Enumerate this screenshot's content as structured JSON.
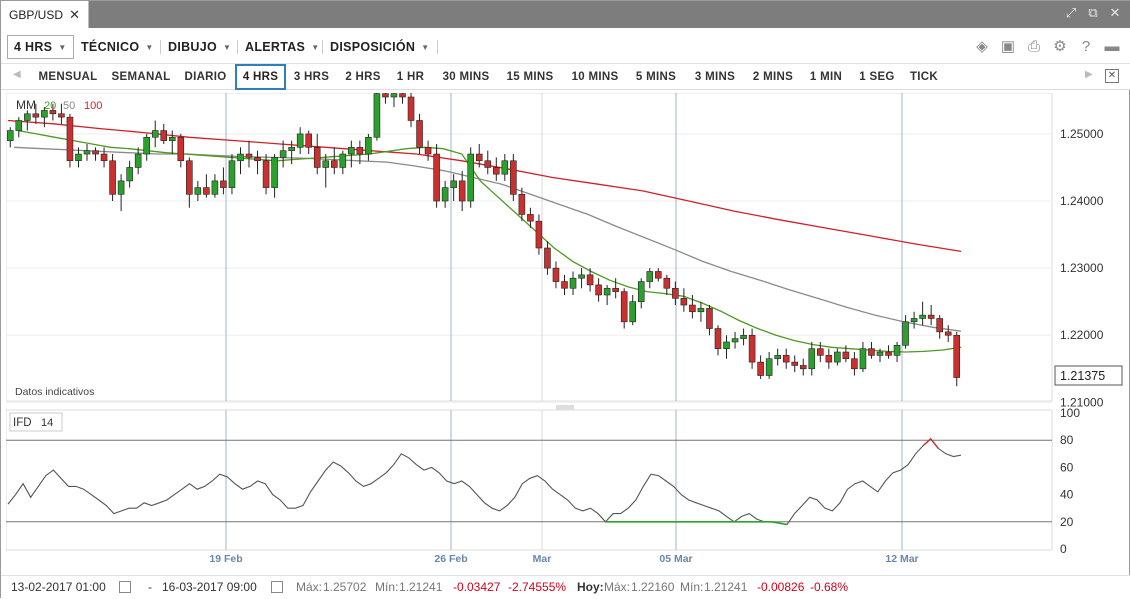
{
  "window": {
    "tab_label": "GBP/USD",
    "close_glyph": "✕"
  },
  "toolbar": {
    "timeframe_label": "4 HRS",
    "menus": [
      "TÉCNICO",
      "DIBUJO",
      "ALERTAS",
      "DISPOSICIÓN"
    ]
  },
  "timeframes": [
    "MENSUAL",
    "SEMANAL",
    "DIARIO",
    "4 HRS",
    "3 HRS",
    "2 HRS",
    "1 HR",
    "30 MINS",
    "15 MINS",
    "10 MINS",
    "5 MINS",
    "3 MINS",
    "2 MINS",
    "1 MIN",
    "1 SEG",
    "TICK"
  ],
  "active_timeframe": "4 HRS",
  "indicator_legend": {
    "name": "MM",
    "p20": "20",
    "p50": "50",
    "p100": "100"
  },
  "indicative_note": "Datos indicativos",
  "current_price": "1.21375",
  "ifd_legend": {
    "name": "IFD",
    "period": "14"
  },
  "footer": {
    "from": "13-02-2017 01:00",
    "dash": "-",
    "to": "16-03-2017 09:00",
    "max_label": "Máx:",
    "max_value": "1.25702",
    "min_label": "Mín:",
    "min_value": "1.21241",
    "change": "-0.03427",
    "change_pct": "-2.74555%",
    "today_label": "Hoy:",
    "today_max_label": "Máx:",
    "today_max_value": "1.22160",
    "today_min_label": "Mín:",
    "today_min_value": "1.21241",
    "today_change": "-0.00826",
    "today_change_pct": "-0.68%"
  },
  "colors": {
    "up": "#2ca02c",
    "down": "#c8312f",
    "ma20": "#4e9a1f",
    "ma50": "#8a8a8a",
    "ma100": "#d0202a"
  },
  "chart_data": [
    {
      "type": "candlestick",
      "title": "GBP/USD",
      "x_ticks": [
        "19 Feb",
        "26 Feb",
        "Mar",
        "05 Mar",
        "12 Mar"
      ],
      "y_ticks": [
        "1.25000",
        "1.24000",
        "1.23000",
        "1.22000",
        "1.21000"
      ],
      "ylim": [
        1.21,
        1.255
      ],
      "ohlc": [
        [
          1.249,
          1.251,
          1.248,
          1.2505
        ],
        [
          1.2505,
          1.2525,
          1.2495,
          1.252
        ],
        [
          1.252,
          1.2535,
          1.2505,
          1.253
        ],
        [
          1.253,
          1.2545,
          1.2515,
          1.2525
        ],
        [
          1.2525,
          1.254,
          1.251,
          1.2535
        ],
        [
          1.2535,
          1.2545,
          1.252,
          1.253
        ],
        [
          1.253,
          1.2545,
          1.2515,
          1.2525
        ],
        [
          1.2525,
          1.253,
          1.245,
          1.246
        ],
        [
          1.246,
          1.248,
          1.245,
          1.247
        ],
        [
          1.247,
          1.2485,
          1.246,
          1.2475
        ],
        [
          1.2475,
          1.248,
          1.246,
          1.247
        ],
        [
          1.247,
          1.248,
          1.245,
          1.246
        ],
        [
          1.246,
          1.247,
          1.24,
          1.241
        ],
        [
          1.241,
          1.244,
          1.2385,
          1.243
        ],
        [
          1.243,
          1.246,
          1.242,
          1.245
        ],
        [
          1.245,
          1.248,
          1.244,
          1.247
        ],
        [
          1.247,
          1.25,
          1.246,
          1.2495
        ],
        [
          1.2495,
          1.252,
          1.248,
          1.2505
        ],
        [
          1.2505,
          1.2515,
          1.2485,
          1.249
        ],
        [
          1.249,
          1.2505,
          1.247,
          1.2495
        ],
        [
          1.2495,
          1.25,
          1.245,
          1.246
        ],
        [
          1.246,
          1.2465,
          1.239,
          1.241
        ],
        [
          1.241,
          1.243,
          1.24,
          1.242
        ],
        [
          1.242,
          1.244,
          1.2405,
          1.241
        ],
        [
          1.241,
          1.244,
          1.2405,
          1.243
        ],
        [
          1.243,
          1.245,
          1.241,
          1.242
        ],
        [
          1.242,
          1.247,
          1.241,
          1.246
        ],
        [
          1.246,
          1.248,
          1.244,
          1.247
        ],
        [
          1.247,
          1.249,
          1.245,
          1.2465
        ],
        [
          1.2465,
          1.2475,
          1.244,
          1.246
        ],
        [
          1.246,
          1.247,
          1.241,
          1.242
        ],
        [
          1.242,
          1.247,
          1.2405,
          1.2465
        ],
        [
          1.2465,
          1.249,
          1.245,
          1.2475
        ],
        [
          1.2475,
          1.249,
          1.2455,
          1.248
        ],
        [
          1.248,
          1.251,
          1.247,
          1.25
        ],
        [
          1.25,
          1.2505,
          1.247,
          1.248
        ],
        [
          1.248,
          1.25,
          1.244,
          1.245
        ],
        [
          1.245,
          1.247,
          1.242,
          1.246
        ],
        [
          1.246,
          1.248,
          1.244,
          1.245
        ],
        [
          1.245,
          1.2475,
          1.244,
          1.247
        ],
        [
          1.247,
          1.249,
          1.245,
          1.248
        ],
        [
          1.248,
          1.249,
          1.2455,
          1.247
        ],
        [
          1.247,
          1.25,
          1.246,
          1.2495
        ],
        [
          1.2495,
          1.257,
          1.249,
          1.256
        ],
        [
          1.256,
          1.2575,
          1.2545,
          1.2555
        ],
        [
          1.2555,
          1.257,
          1.254,
          1.256
        ],
        [
          1.256,
          1.2572,
          1.2545,
          1.2555
        ],
        [
          1.2555,
          1.257,
          1.251,
          1.252
        ],
        [
          1.252,
          1.253,
          1.247,
          1.248
        ],
        [
          1.248,
          1.249,
          1.246,
          1.247
        ],
        [
          1.247,
          1.2485,
          1.239,
          1.24
        ],
        [
          1.24,
          1.243,
          1.239,
          1.242
        ],
        [
          1.242,
          1.244,
          1.24,
          1.243
        ],
        [
          1.243,
          1.2445,
          1.2385,
          1.24
        ],
        [
          1.24,
          1.248,
          1.239,
          1.247
        ],
        [
          1.247,
          1.2485,
          1.245,
          1.246
        ],
        [
          1.246,
          1.2475,
          1.244,
          1.245
        ],
        [
          1.245,
          1.2465,
          1.243,
          1.244
        ],
        [
          1.244,
          1.247,
          1.243,
          1.246
        ],
        [
          1.246,
          1.247,
          1.24,
          1.241
        ],
        [
          1.241,
          1.242,
          1.237,
          1.238
        ],
        [
          1.238,
          1.239,
          1.236,
          1.237
        ],
        [
          1.237,
          1.238,
          1.232,
          1.233
        ],
        [
          1.233,
          1.234,
          1.229,
          1.23
        ],
        [
          1.23,
          1.231,
          1.227,
          1.228
        ],
        [
          1.228,
          1.229,
          1.226,
          1.227
        ],
        [
          1.227,
          1.2295,
          1.226,
          1.2285
        ],
        [
          1.2285,
          1.23,
          1.227,
          1.229
        ],
        [
          1.229,
          1.23,
          1.2265,
          1.2275
        ],
        [
          1.2275,
          1.2285,
          1.225,
          1.226
        ],
        [
          1.226,
          1.2275,
          1.2245,
          1.227
        ],
        [
          1.227,
          1.2285,
          1.2255,
          1.2265
        ],
        [
          1.2265,
          1.227,
          1.221,
          1.222
        ],
        [
          1.222,
          1.226,
          1.2215,
          1.225
        ],
        [
          1.225,
          1.2285,
          1.224,
          1.228
        ],
        [
          1.228,
          1.23,
          1.227,
          1.2295
        ],
        [
          1.2295,
          1.23,
          1.228,
          1.2285
        ],
        [
          1.2285,
          1.229,
          1.226,
          1.227
        ],
        [
          1.227,
          1.228,
          1.2245,
          1.2255
        ],
        [
          1.2255,
          1.227,
          1.2235,
          1.2245
        ],
        [
          1.2245,
          1.226,
          1.2225,
          1.2235
        ],
        [
          1.2235,
          1.225,
          1.222,
          1.224
        ],
        [
          1.224,
          1.2245,
          1.22,
          1.221
        ],
        [
          1.221,
          1.2215,
          1.217,
          1.218
        ],
        [
          1.218,
          1.22,
          1.2165,
          1.219
        ],
        [
          1.219,
          1.2205,
          1.218,
          1.2195
        ],
        [
          1.2195,
          1.221,
          1.2185,
          1.22
        ],
        [
          1.22,
          1.221,
          1.215,
          1.216
        ],
        [
          1.216,
          1.217,
          1.2135,
          1.214
        ],
        [
          1.214,
          1.2175,
          1.2135,
          1.2165
        ],
        [
          1.2165,
          1.218,
          1.2155,
          1.217
        ],
        [
          1.217,
          1.218,
          1.215,
          1.216
        ],
        [
          1.216,
          1.217,
          1.2145,
          1.2155
        ],
        [
          1.2155,
          1.2165,
          1.214,
          1.215
        ],
        [
          1.215,
          1.219,
          1.214,
          1.218
        ],
        [
          1.218,
          1.219,
          1.216,
          1.217
        ],
        [
          1.217,
          1.218,
          1.215,
          1.216
        ],
        [
          1.216,
          1.218,
          1.2155,
          1.2175
        ],
        [
          1.2175,
          1.2185,
          1.216,
          1.2165
        ],
        [
          1.2165,
          1.2175,
          1.214,
          1.215
        ],
        [
          1.215,
          1.219,
          1.2145,
          1.218
        ],
        [
          1.218,
          1.219,
          1.2165,
          1.217
        ],
        [
          1.217,
          1.218,
          1.216,
          1.2175
        ],
        [
          1.2175,
          1.2185,
          1.2165,
          1.217
        ],
        [
          1.217,
          1.219,
          1.216,
          1.2185
        ],
        [
          1.2185,
          1.223,
          1.218,
          1.222
        ],
        [
          1.222,
          1.2235,
          1.221,
          1.2225
        ],
        [
          1.2225,
          1.225,
          1.2215,
          1.223
        ],
        [
          1.223,
          1.2245,
          1.2215,
          1.2225
        ],
        [
          1.2225,
          1.223,
          1.2195,
          1.2205
        ],
        [
          1.2205,
          1.2215,
          1.219,
          1.22
        ],
        [
          1.22,
          1.2205,
          1.2124,
          1.2137
        ]
      ],
      "ma20": [
        1.2505,
        1.25,
        1.2495,
        1.249,
        1.2485,
        1.248,
        1.2478,
        1.2475,
        1.2472,
        1.247,
        1.2468,
        1.2466,
        1.2464,
        1.2462,
        1.246,
        1.2462,
        1.2464,
        1.2466,
        1.2468,
        1.247,
        1.2474,
        1.2478,
        1.248,
        1.2478,
        1.247,
        1.243,
        1.2405,
        1.238,
        1.2355,
        1.233,
        1.231,
        1.2295,
        1.2282,
        1.2272,
        1.2265,
        1.2262,
        1.2258,
        1.2248,
        1.2236,
        1.2222,
        1.221,
        1.22,
        1.2192,
        1.2186,
        1.2182,
        1.218,
        1.2178,
        1.2176,
        1.2175,
        1.2176,
        1.2178,
        1.2182
      ],
      "ma50": [
        1.248,
        1.2478,
        1.2476,
        1.2474,
        1.2472,
        1.247,
        1.247,
        1.2468,
        1.2466,
        1.2465,
        1.2464,
        1.2462,
        1.246,
        1.2458,
        1.2452,
        1.2445,
        1.2435,
        1.2425,
        1.241,
        1.2395,
        1.238,
        1.2362,
        1.2345,
        1.2328,
        1.231,
        1.2295,
        1.2282,
        1.2268,
        1.2255,
        1.2242,
        1.223,
        1.222,
        1.2212,
        1.2206
      ],
      "ma100": [
        1.252,
        1.2515,
        1.2508,
        1.2502,
        1.2495,
        1.249,
        1.2485,
        1.248,
        1.2475,
        1.247,
        1.246,
        1.2448,
        1.2435,
        1.2425,
        1.2415,
        1.24,
        1.2385,
        1.2372,
        1.236,
        1.2348,
        1.2336,
        1.2325
      ]
    },
    {
      "type": "line",
      "title": "IFD 14",
      "y_ticks": [
        "100",
        "80",
        "60",
        "40",
        "20",
        "0"
      ],
      "ylim": [
        0,
        100
      ],
      "reference_lines": [
        80,
        20
      ],
      "values": [
        33,
        40,
        48,
        38,
        46,
        54,
        58,
        52,
        46,
        46,
        44,
        40,
        36,
        32,
        26,
        28,
        30,
        30,
        34,
        32,
        34,
        36,
        40,
        44,
        48,
        44,
        46,
        50,
        55,
        53,
        48,
        44,
        46,
        50,
        48,
        40,
        36,
        30,
        30,
        32,
        42,
        50,
        58,
        64,
        61,
        56,
        50,
        46,
        48,
        52,
        56,
        62,
        70,
        67,
        62,
        58,
        60,
        56,
        50,
        48,
        50,
        46,
        40,
        34,
        30,
        28,
        32,
        38,
        48,
        52,
        54,
        50,
        44,
        40,
        36,
        30,
        28,
        30,
        26,
        20,
        26,
        26,
        30,
        36,
        46,
        55,
        54,
        50,
        46,
        40,
        36,
        34,
        32,
        30,
        28,
        24,
        20,
        24,
        26,
        22,
        20,
        20,
        19,
        18,
        26,
        32,
        38,
        36,
        30,
        28,
        34,
        44,
        48,
        50,
        46,
        42,
        50,
        56,
        58,
        62,
        70,
        76,
        81,
        74,
        70,
        68,
        69
      ]
    }
  ]
}
